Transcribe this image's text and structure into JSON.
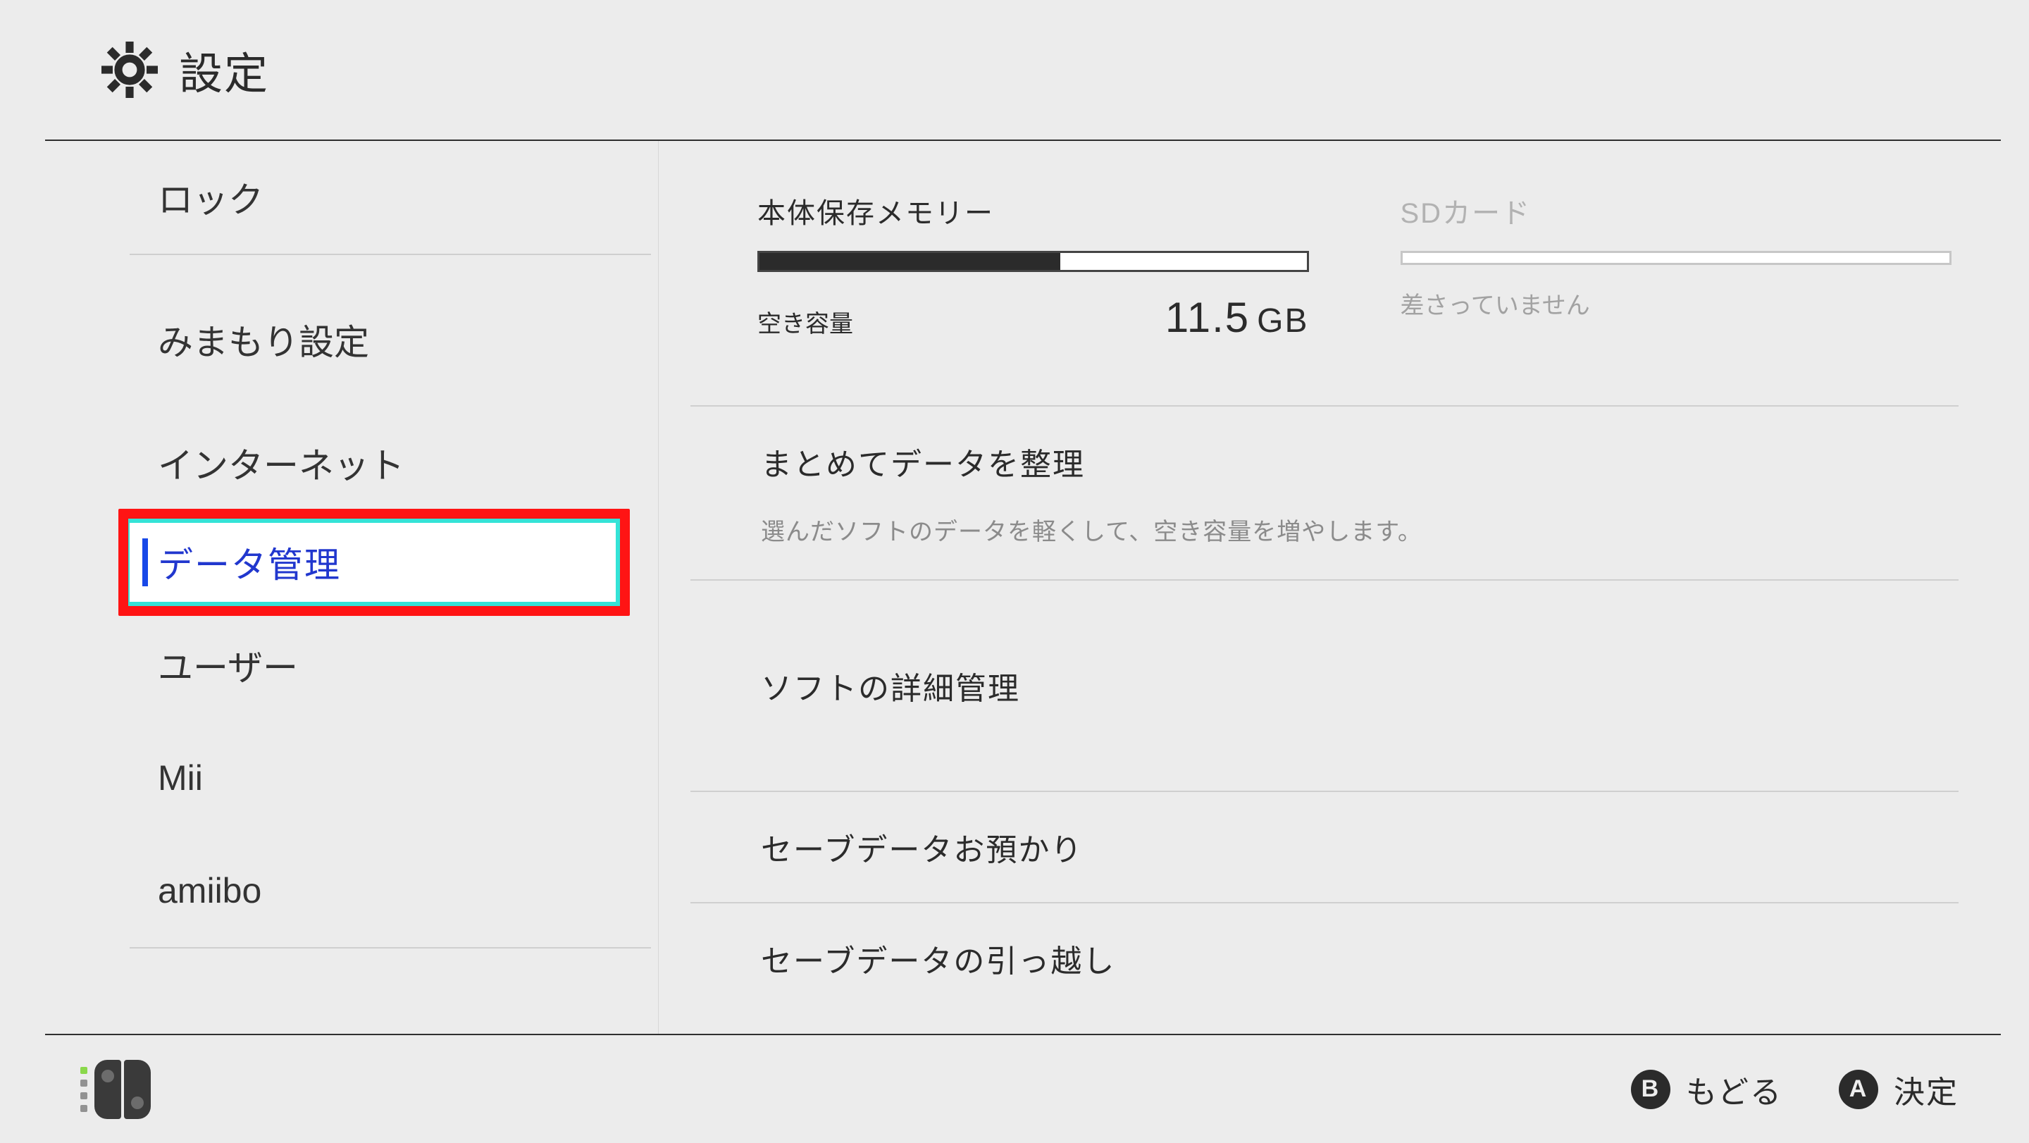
{
  "header": {
    "title": "設定"
  },
  "sidebar": {
    "items": [
      {
        "label": "ロック"
      },
      {
        "label": "みまもり設定"
      },
      {
        "label": "インターネット"
      },
      {
        "label": "データ管理",
        "selected": true,
        "highlighted": true
      },
      {
        "label": "ユーザー"
      },
      {
        "label": "Mii"
      },
      {
        "label": "amiibo"
      }
    ]
  },
  "storage": {
    "system": {
      "title": "本体保存メモリー",
      "free_label": "空き容量",
      "free_value": "11.5",
      "free_unit": "GB",
      "used_percent": 55
    },
    "sd": {
      "title": "SDカード",
      "status": "差さっていません",
      "used_percent": 0
    }
  },
  "menu": {
    "items": [
      {
        "title": "まとめてデータを整理",
        "desc": "選んだソフトのデータを軽くして、空き容量を増やします。"
      },
      {
        "title": "ソフトの詳細管理"
      },
      {
        "title": "セーブデータお預かり"
      },
      {
        "title": "セーブデータの引っ越し"
      }
    ]
  },
  "footer": {
    "back": {
      "button": "B",
      "label": "もどる"
    },
    "ok": {
      "button": "A",
      "label": "決定"
    }
  }
}
